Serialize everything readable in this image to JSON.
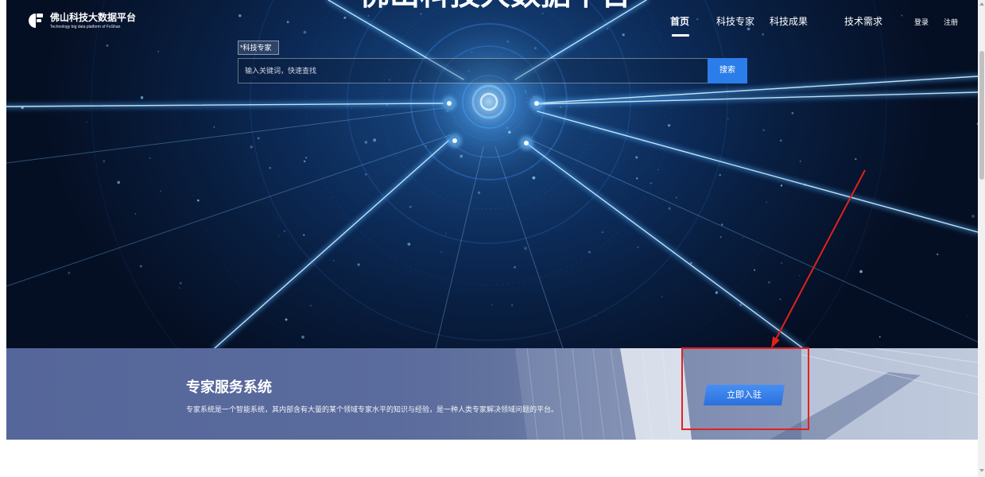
{
  "header": {
    "logo_title": "佛山科技大数据平台",
    "logo_subtitle": "Technology big data platform of FoShan",
    "nav": [
      {
        "label": "首页",
        "active": true
      },
      {
        "label": "科技专家",
        "active": false
      },
      {
        "label": "科技成果",
        "active": false
      },
      {
        "label": "技术需求",
        "active": false
      }
    ],
    "login_label": "登录",
    "register_label": "注册"
  },
  "hero": {
    "title": "佛山科技大数据平台"
  },
  "search": {
    "category": "*科技专家",
    "placeholder": "输入关键词，快速查找",
    "value": "",
    "button_label": "搜索"
  },
  "banner": {
    "title": "专家服务系统",
    "description": "专家系统是一个智能系统，其内部含有大量的某个领域专家水平的知识与经验，是一种人类专家解决领域问题的平台。",
    "cta_label": "立即入驻"
  },
  "icons": {
    "logo": "logo-icon",
    "scroll_up": "scroll-up-icon",
    "scroll_down": "scroll-down-icon"
  },
  "colors": {
    "hero_background": "#0c2a57",
    "accent_blue": "#2b7de9",
    "banner_background": "#5a6b9d",
    "annotation_red": "#e3211d",
    "text_on_dark": "#ffffff"
  }
}
